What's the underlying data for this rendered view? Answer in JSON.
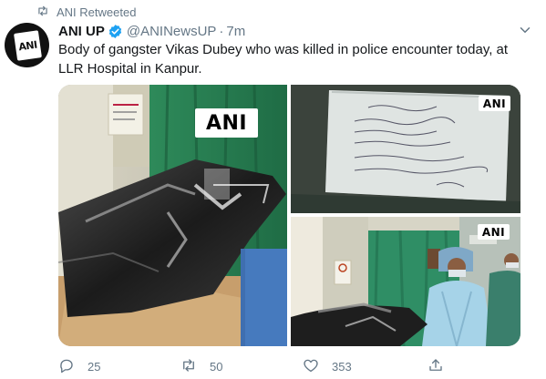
{
  "retweet": {
    "label": "ANI Retweeted",
    "icon": "retweet-icon"
  },
  "author": {
    "display_name": "ANI UP",
    "handle": "@ANINewsUP",
    "time": "7m",
    "verified": true,
    "avatar_text": "ANI"
  },
  "tweet": {
    "text": "Body of gangster Vikas Dubey who was killed in police encounter today, at LLR Hospital in Kanpur."
  },
  "media": {
    "watermark": "ANI"
  },
  "actions": {
    "reply_count": "25",
    "retweet_count": "50",
    "like_count": "353"
  },
  "colors": {
    "accent": "#1da1f2",
    "muted": "#657786",
    "text": "#14171a"
  }
}
